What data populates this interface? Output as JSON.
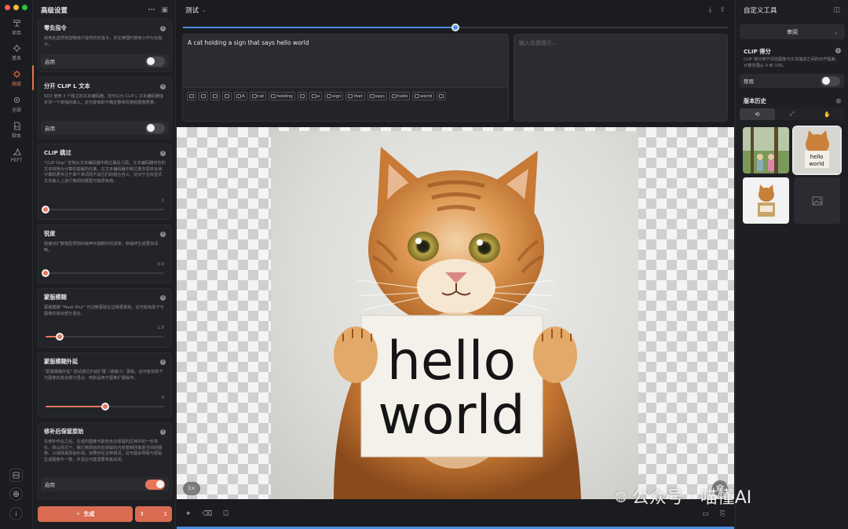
{
  "window": {
    "traffic_lights": [
      "#fe5f57",
      "#febc2e",
      "#28c840"
    ]
  },
  "rail": {
    "items": [
      {
        "label": "项目",
        "icon": "project-icon"
      },
      {
        "label": "基本",
        "icon": "basic-icon"
      },
      {
        "label": "高级",
        "icon": "advanced-icon",
        "active": true
      },
      {
        "label": "全部",
        "icon": "all-icon"
      },
      {
        "label": "脚本",
        "icon": "script-icon"
      },
      {
        "label": "PEFT",
        "icon": "peft-icon"
      }
    ]
  },
  "settings": {
    "title": "高级设置",
    "zero_neg": {
      "title": "零负指令",
      "desc": "启用此选项将忽略用户提供的负指令，并在推理时使用０作为负指令。",
      "toggle_label": "启用",
      "on": false
    },
    "clip_l": {
      "title": "分开 CLIP L 文本",
      "desc": "SD3 使用 3 个独立的文本编码器。您可以为 CLIP L 文本编码器指定另一个单独的输入。这可能有助于确定整体风格和图像质量。",
      "toggle_label": "启用",
      "on": false
    },
    "clip_skip": {
      "title": "CLIP 跳过",
      "desc": "\"CLIP Skip\" 控制从文本编码器中跳过最后几层。文本编码器将您的文本转换为计算机理解的向量。在文本编码器中跳过更多层将会使计算机更专注于单个单词而不是它们的组合含义。这对于在标签式文本输入上进行微调的模型可能很有用。",
      "value": "1",
      "fraction": 0.0
    },
    "sharpness": {
      "title": "锐度",
      "desc": "锐度对扩散模型预测的噪声实施额外的滤波，使最终生成更加清晰。",
      "value": "0.0",
      "fraction": 0.0
    },
    "mask_blur": {
      "title": "蒙版模糊",
      "desc": "蒙版模糊 \"Mask Blur\" 可试使蒙版在边缘更柔和。这可能有助于与图像的其余部分混合。",
      "value": "1.5",
      "fraction": 0.12
    },
    "mask_blur_outset": {
      "title": "蒙版模糊外延",
      "desc": "\"蒙版模糊外延\" 尝试通过外延扩展（或缩小）蒙版。这可能有助于与图像的其余部分混合，特别是用于图像扩展操作。",
      "value": "0",
      "fraction": 0.5
    },
    "preserve": {
      "title": "修补后保留原始",
      "desc": "在修补作业之后，生成的图像可能包含应保留的区域中的一些变化。默认情况下，我们将原始的应保留的内容复制回像素空间的图像，以保持其原始外观。如果存在这种情况，这可能会导致与原始生成图像不一致，并且应可能需要将其关闭。",
      "toggle_label": "启用",
      "on": true
    },
    "generate": {
      "label": "生成",
      "count": "1"
    }
  },
  "main": {
    "title": "测试",
    "progress_fraction": 0.5,
    "prompt": "A cat holding a sign that says hello world",
    "tokens": [
      "",
      "",
      "",
      "",
      "A",
      "cat",
      "holding",
      "",
      "a",
      "sign",
      "that",
      "says",
      "hello",
      "world",
      ""
    ],
    "neg_placeholder": "输入负面提示…",
    "zoom": "1×",
    "sign_text": [
      "hello",
      "world"
    ]
  },
  "right": {
    "title": "自定义工具",
    "review": "审阅",
    "clip_score": {
      "title": "CLIP 得分",
      "desc": "CLIP 得分用于评估图像与文本描述之间的对齐程度，计算范围从 0 到 100。",
      "toggle_label": "禁用",
      "on": false
    },
    "history_title": "版本历史"
  },
  "watermark": "公众号 · 喵懂AI"
}
